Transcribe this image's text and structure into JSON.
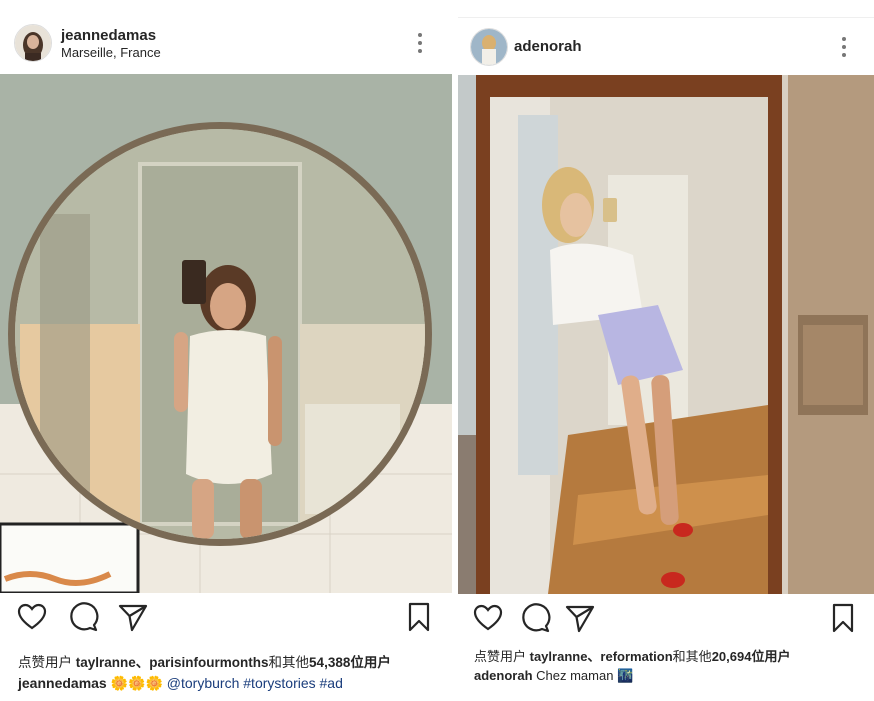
{
  "left_post": {
    "username": "jeannedamas",
    "location": "Marseille, France",
    "likes_prefix": "点赞用户 ",
    "likes_users": "taylranne、parisinfourmonths",
    "likes_mid": "和其他",
    "likes_count": "54,388",
    "likes_suffix": "位用户",
    "caption_user": "jeannedamas",
    "caption_emoji": "🌼🌼🌼",
    "caption_mention": "@toryburch",
    "caption_tags": "#torystories #ad"
  },
  "right_post": {
    "username": "adenorah",
    "likes_prefix": "点赞用户 ",
    "likes_users": "taylranne、reformation",
    "likes_mid": "和其他",
    "likes_count": "20,694",
    "likes_suffix": "位用户",
    "caption_user": "adenorah",
    "caption_text": "Chez maman",
    "caption_emoji": "🌃"
  },
  "icons": {
    "like": "heart-icon",
    "comment": "comment-icon",
    "share": "send-icon",
    "save": "bookmark-icon",
    "more": "more-options-icon"
  }
}
